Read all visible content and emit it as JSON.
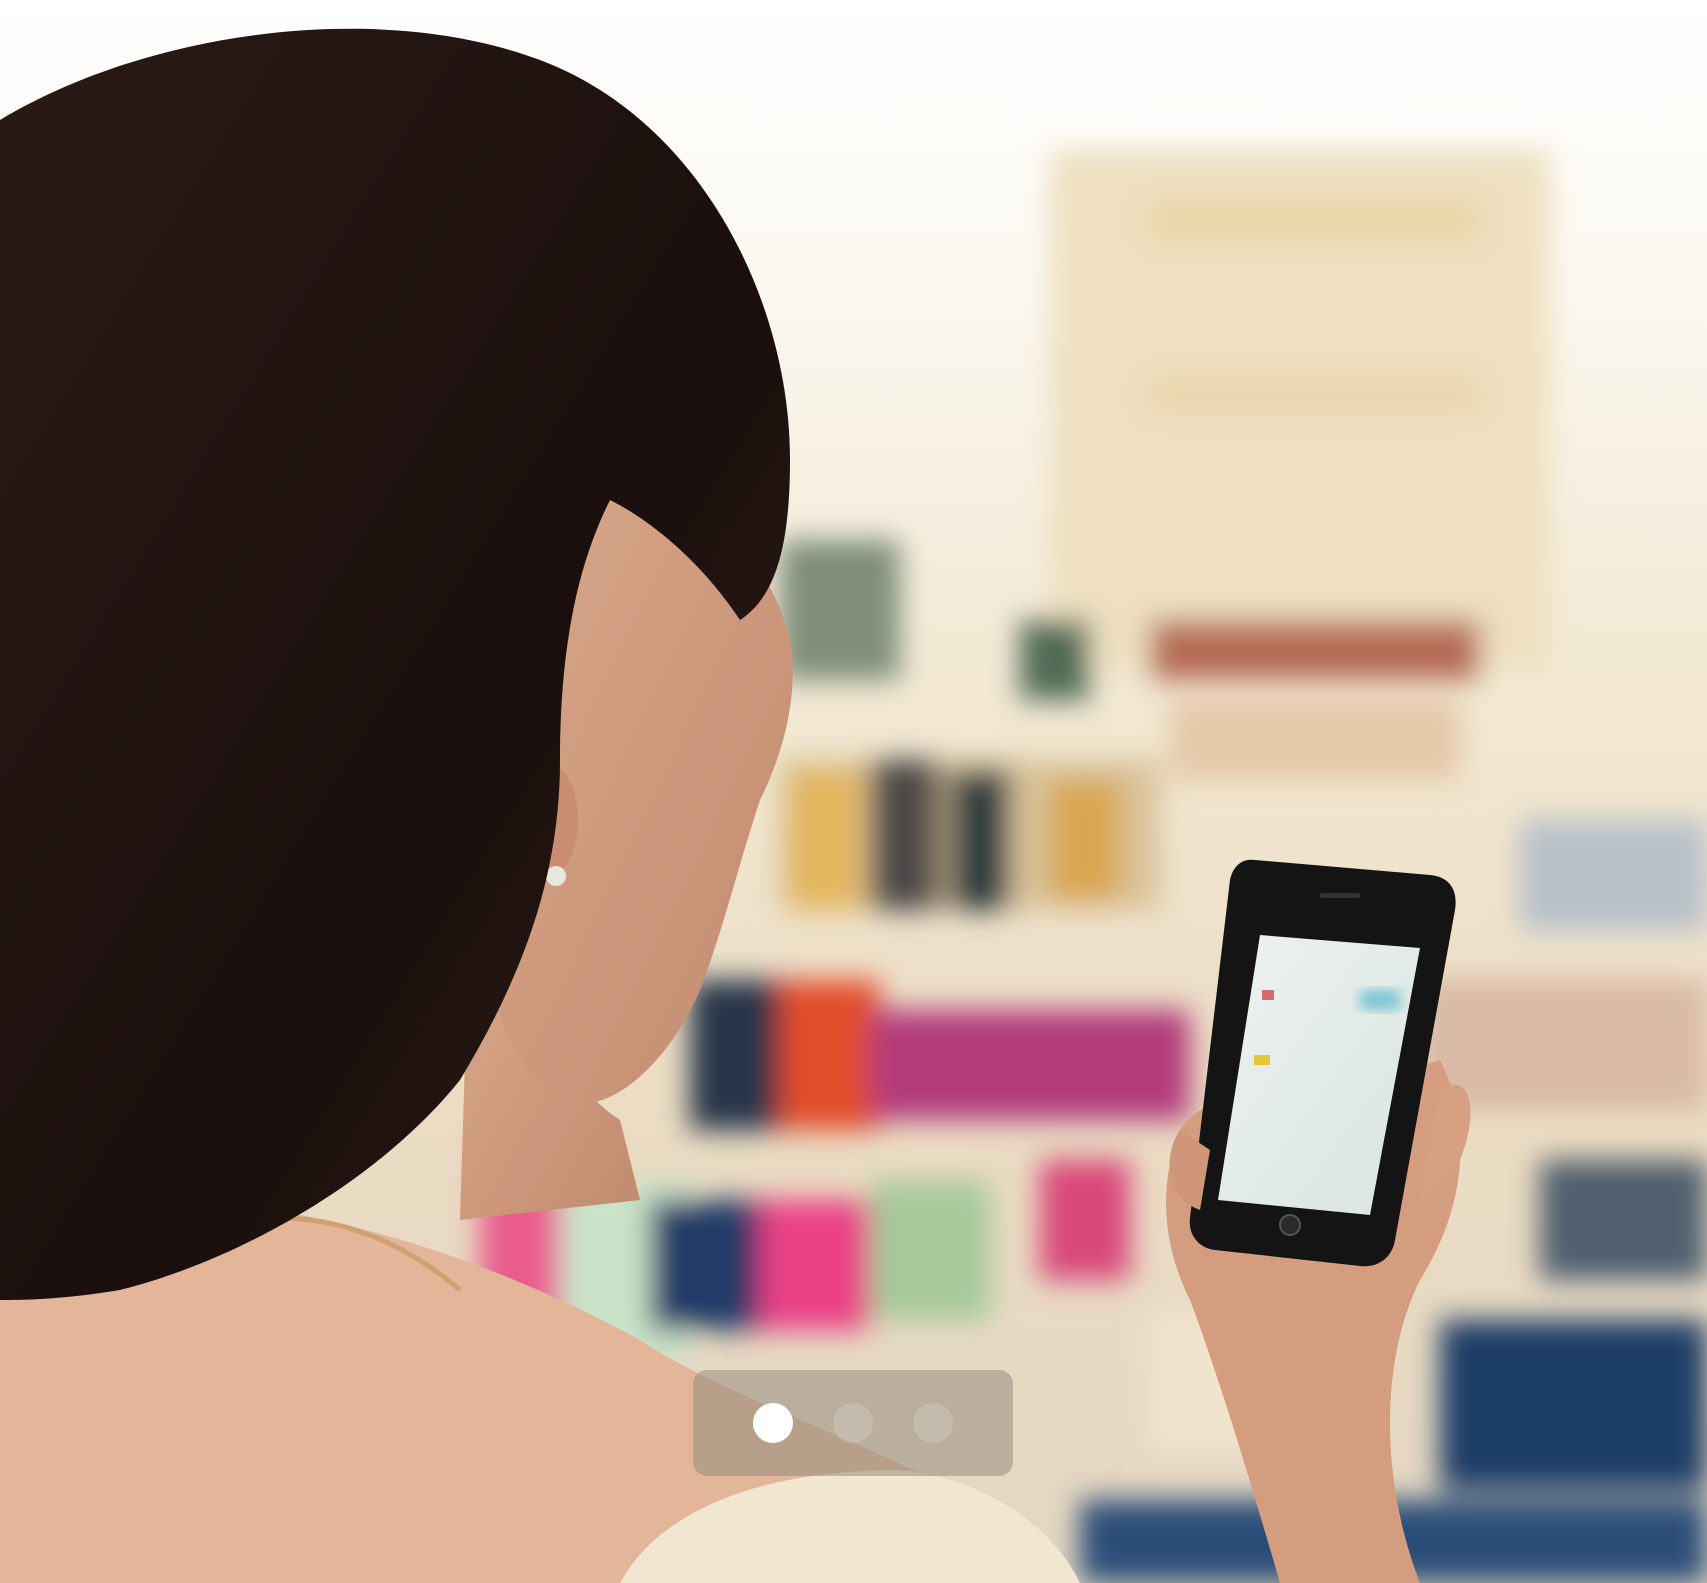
{
  "carousel": {
    "slide_count": 3,
    "active_index": 0,
    "slides": [
      {
        "name": "slide-1"
      },
      {
        "name": "slide-2"
      },
      {
        "name": "slide-3"
      }
    ]
  },
  "colors": {
    "active_dot": "#ffffff",
    "inactive_dot": "#cdc6bc",
    "pager_background": "#968c7d"
  }
}
